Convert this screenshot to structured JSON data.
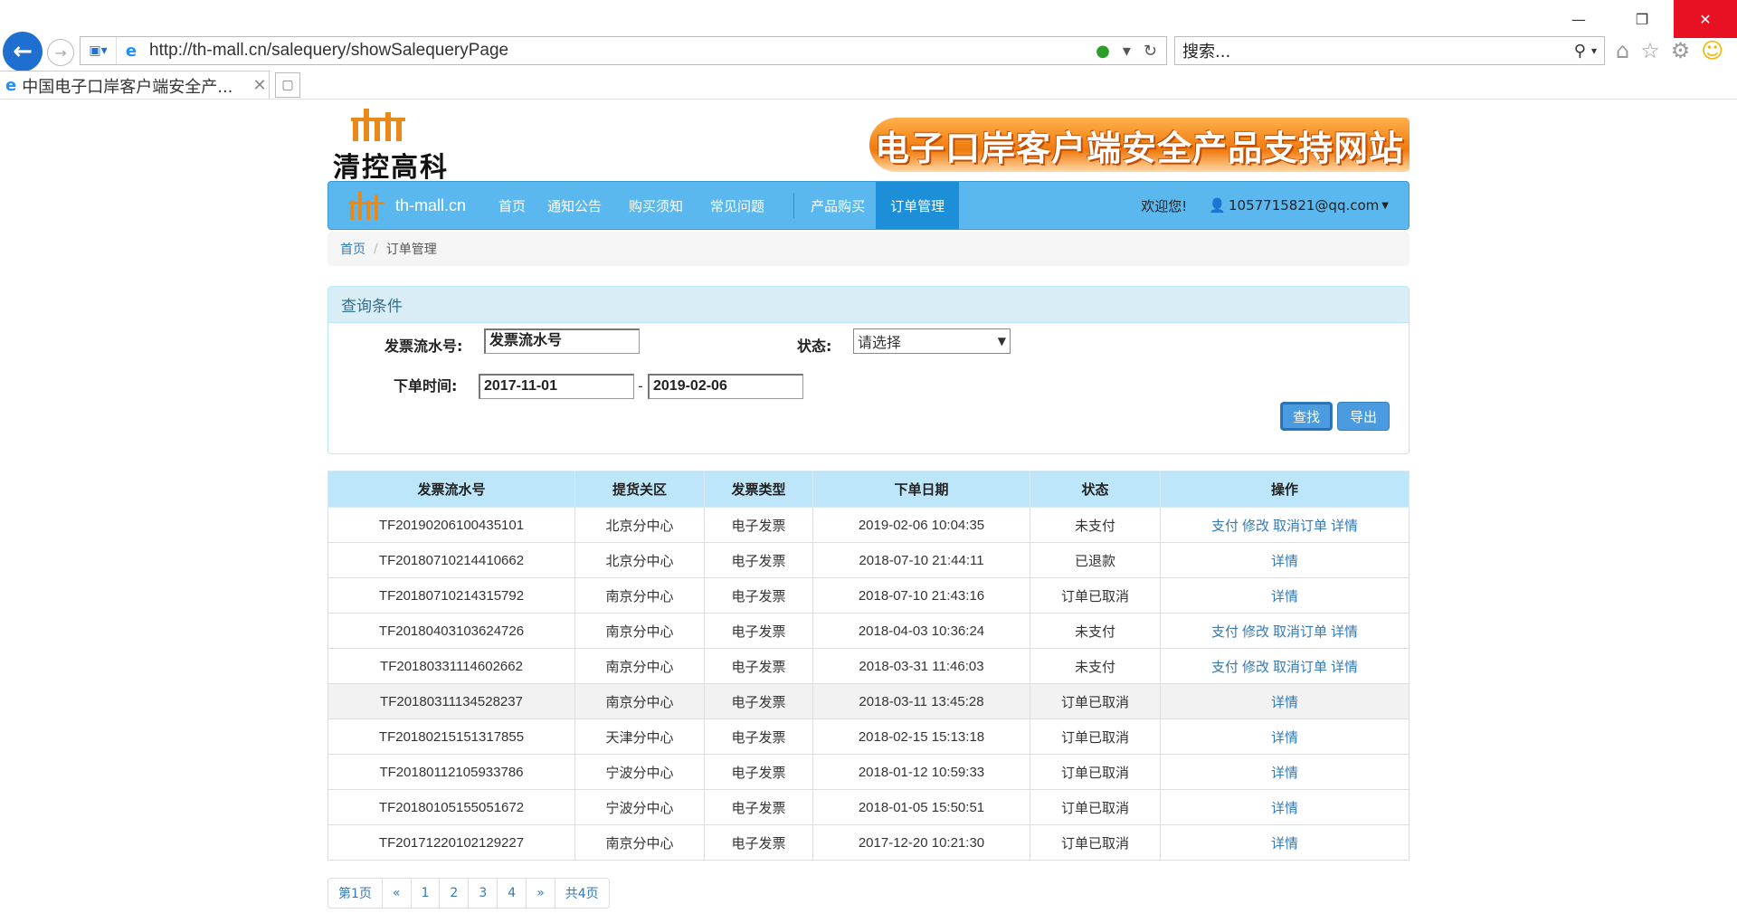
{
  "browser": {
    "url": "http://th-mall.cn/salequery/showSalequeryPage",
    "search_placeholder": "搜索...",
    "tab_title": "中国电子口岸客户端安全产...",
    "minimize_label": "—",
    "restore_label": "❐",
    "close_label": "✕"
  },
  "header": {
    "logo_text": "清控高科",
    "slogan": "电子口岸客户端安全产品支持网站"
  },
  "nav": {
    "brand": "th-mall.cn",
    "items": [
      {
        "label": "首页"
      },
      {
        "label": "通知公告"
      },
      {
        "label": "购买须知"
      },
      {
        "label": "常见问题"
      },
      {
        "label": "产品购买"
      },
      {
        "label": "订单管理",
        "active": true
      }
    ],
    "welcome": "欢迎您!",
    "user": "1057715821@qq.com"
  },
  "breadcrumb": {
    "home": "首页",
    "current": "订单管理"
  },
  "query": {
    "title": "查询条件",
    "invoice_label": "发票流水号:",
    "invoice_value": "发票流水号",
    "status_label": "状态:",
    "status_value": "请选择",
    "time_label": "下单时间:",
    "date_from": "2017-11-01",
    "date_to": "2019-02-06",
    "dash": "-",
    "search_btn": "查找",
    "export_btn": "导出"
  },
  "table": {
    "headers": [
      "发票流水号",
      "提货关区",
      "发票类型",
      "下单日期",
      "状态",
      "操作"
    ],
    "rows": [
      {
        "code": "TF20190206100435101",
        "region": "北京分中心",
        "type": "电子发票",
        "date": "2019-02-06 10:04:35",
        "status": "未支付",
        "actions": [
          "支付",
          "修改",
          "取消订单",
          "详情"
        ]
      },
      {
        "code": "TF20180710214410662",
        "region": "北京分中心",
        "type": "电子发票",
        "date": "2018-07-10 21:44:11",
        "status": "已退款",
        "actions": [
          "详情"
        ]
      },
      {
        "code": "TF20180710214315792",
        "region": "南京分中心",
        "type": "电子发票",
        "date": "2018-07-10 21:43:16",
        "status": "订单已取消",
        "actions": [
          "详情"
        ]
      },
      {
        "code": "TF20180403103624726",
        "region": "南京分中心",
        "type": "电子发票",
        "date": "2018-04-03 10:36:24",
        "status": "未支付",
        "actions": [
          "支付",
          "修改",
          "取消订单",
          "详情"
        ]
      },
      {
        "code": "TF20180331114602662",
        "region": "南京分中心",
        "type": "电子发票",
        "date": "2018-03-31 11:46:03",
        "status": "未支付",
        "actions": [
          "支付",
          "修改",
          "取消订单",
          "详情"
        ]
      },
      {
        "code": "TF20180311134528237",
        "region": "南京分中心",
        "type": "电子发票",
        "date": "2018-03-11 13:45:28",
        "status": "订单已取消",
        "actions": [
          "详情"
        ],
        "highlight": true
      },
      {
        "code": "TF20180215151317855",
        "region": "天津分中心",
        "type": "电子发票",
        "date": "2018-02-15 15:13:18",
        "status": "订单已取消",
        "actions": [
          "详情"
        ]
      },
      {
        "code": "TF20180112105933786",
        "region": "宁波分中心",
        "type": "电子发票",
        "date": "2018-01-12 10:59:33",
        "status": "订单已取消",
        "actions": [
          "详情"
        ]
      },
      {
        "code": "TF20180105155051672",
        "region": "宁波分中心",
        "type": "电子发票",
        "date": "2018-01-05 15:50:51",
        "status": "订单已取消",
        "actions": [
          "详情"
        ]
      },
      {
        "code": "TF20171220102129227",
        "region": "南京分中心",
        "type": "电子发票",
        "date": "2017-12-20 10:21:30",
        "status": "订单已取消",
        "actions": [
          "详情"
        ]
      }
    ]
  },
  "pager": {
    "items": [
      "第1页",
      "«",
      "1",
      "2",
      "3",
      "4",
      "»",
      "共4页"
    ]
  },
  "colors": {
    "nav_bg": "#5bb8ee",
    "nav_active": "#1d8fd8",
    "link": "#337ab7",
    "table_header": "#bde6fa",
    "button": "#4a9be0"
  },
  "icons": {
    "back": "back-arrow-icon",
    "forward": "forward-arrow-icon",
    "search": "search-icon",
    "home": "home-icon",
    "favorites": "star-icon",
    "settings": "gear-icon",
    "feedback": "smiley-icon",
    "user": "user-icon"
  }
}
